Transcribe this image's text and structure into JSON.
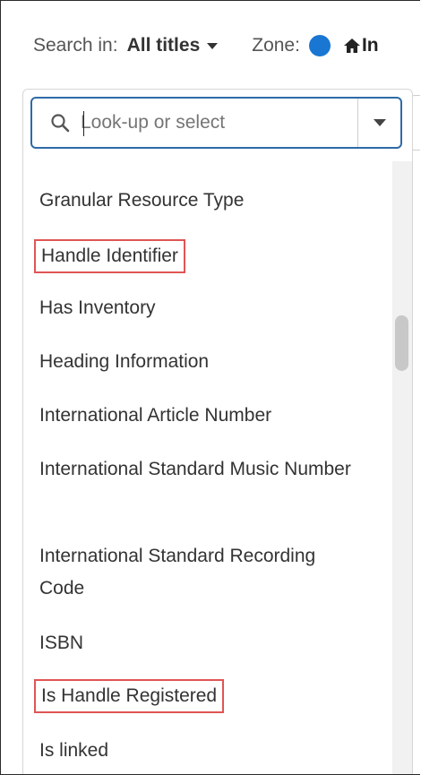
{
  "toolbar": {
    "search_in_label": "Search in:",
    "search_in_value": "All titles",
    "zone_label": "Zone:",
    "home_partial_text": "In"
  },
  "colors": {
    "zone_dot": "#1976d2",
    "search_border": "#2f6aa8",
    "highlight_border": "#e05555"
  },
  "search": {
    "placeholder": "Look-up or select",
    "value": ""
  },
  "icons": {
    "search": "search-icon",
    "dropdown": "chevron-down-icon",
    "home": "home-icon"
  },
  "list": {
    "items": [
      {
        "label": "Granular Resource Type",
        "highlighted": false
      },
      {
        "label": "Handle Identifier",
        "highlighted": true
      },
      {
        "label": "Has Inventory",
        "highlighted": false
      },
      {
        "label": "Heading Information",
        "highlighted": false
      },
      {
        "label": "International Article Number",
        "highlighted": false
      },
      {
        "label": "International Standard Music Number",
        "highlighted": false
      },
      {
        "label": "International Standard Recording Code",
        "highlighted": false
      },
      {
        "label": "ISBN",
        "highlighted": false
      },
      {
        "label": "Is Handle Registered",
        "highlighted": true
      },
      {
        "label": "Is linked",
        "highlighted": false
      }
    ]
  }
}
